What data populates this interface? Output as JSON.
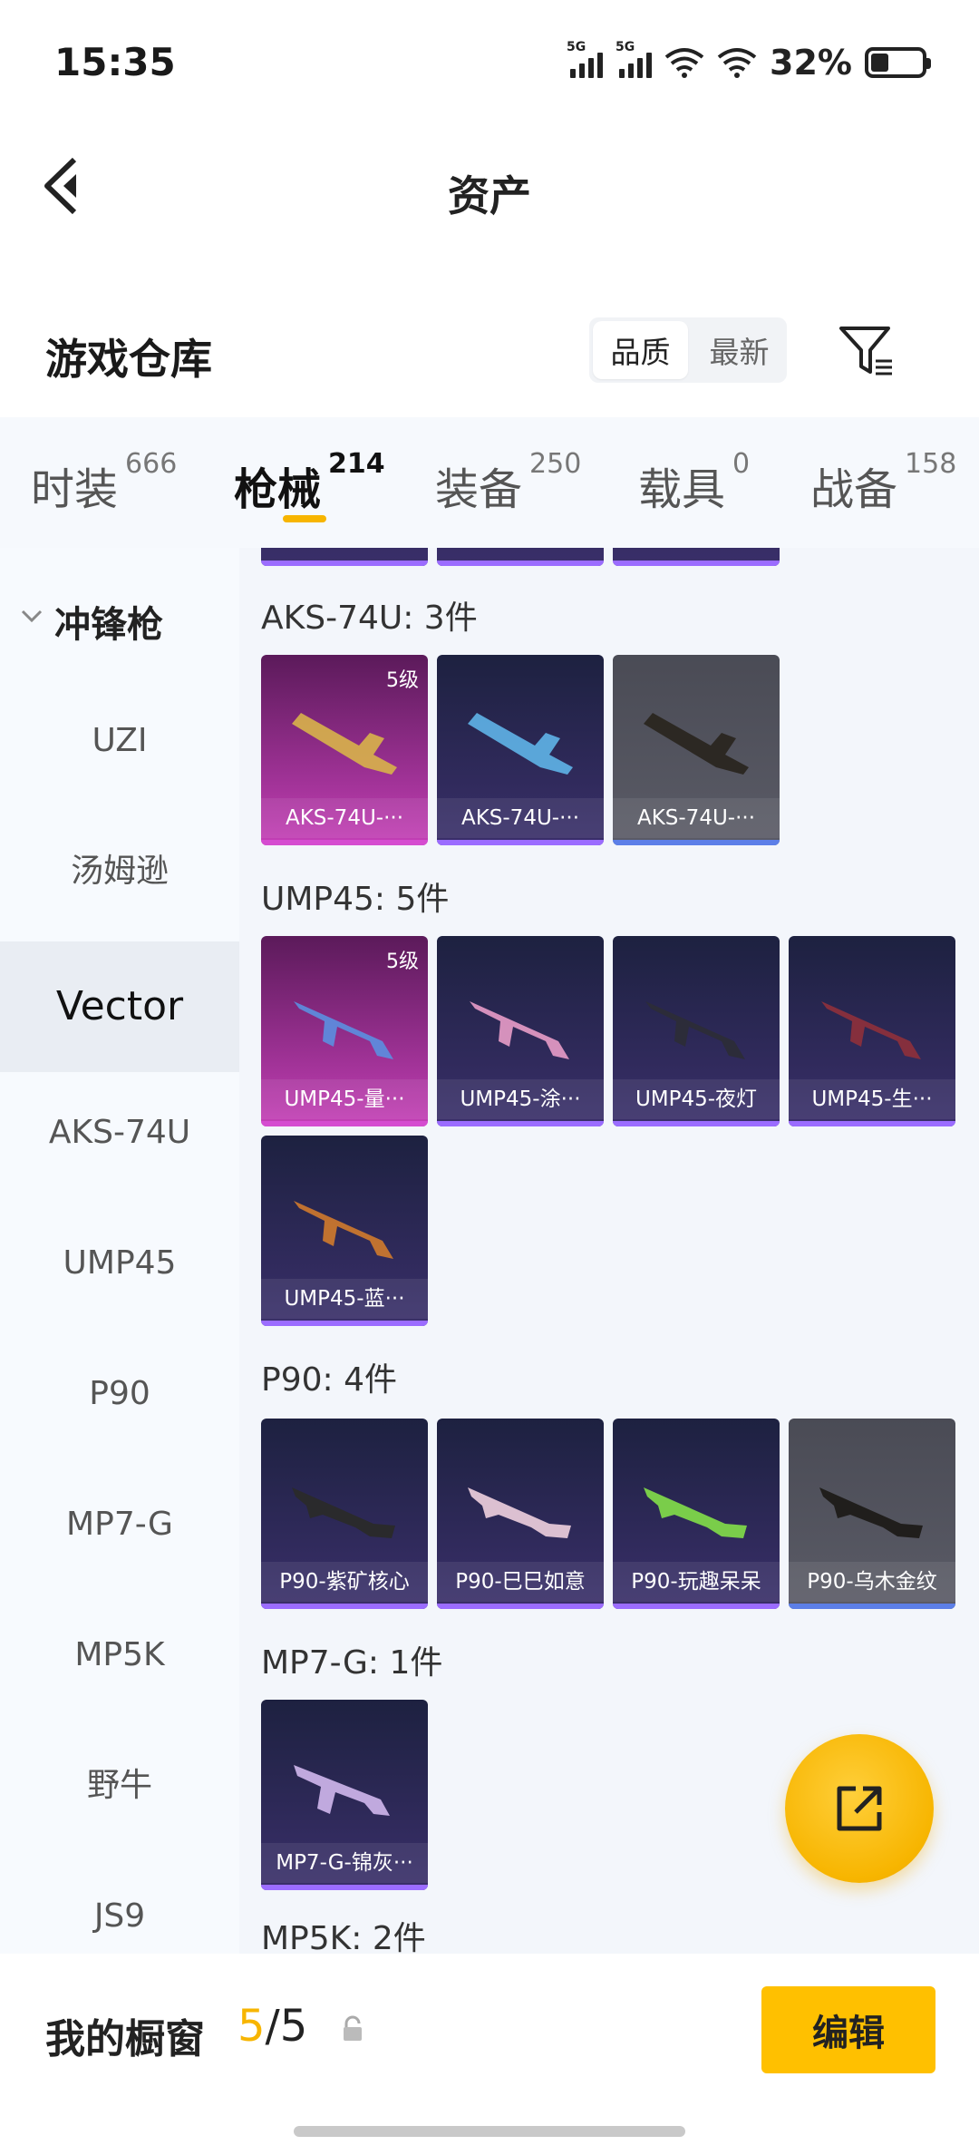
{
  "status_bar": {
    "time": "15:35",
    "signal1_tag": "5G",
    "signal2_tag": "5G",
    "battery": "32%"
  },
  "header": {
    "title": "资产"
  },
  "warehouse": {
    "title": "游戏仓库",
    "sort_quality": "品质",
    "sort_latest": "最新"
  },
  "tabs": [
    {
      "label": "时装",
      "count": "666"
    },
    {
      "label": "枪械",
      "count": "214"
    },
    {
      "label": "装备",
      "count": "250"
    },
    {
      "label": "载具",
      "count": "0"
    },
    {
      "label": "战备",
      "count": "158"
    }
  ],
  "categories": {
    "group": "冲锋枪",
    "items": [
      "UZI",
      "汤姆逊",
      "Vector",
      "AKS-74U",
      "UMP45",
      "P90",
      "MP7-G",
      "MP5K",
      "野牛",
      "JS9"
    ],
    "selected": "Vector"
  },
  "sections": {
    "aks": {
      "title": "AKS-74U: 3件",
      "items": [
        {
          "label": "AKS-74U-···",
          "level": "5级",
          "rarity": "purple"
        },
        {
          "label": "AKS-74U-···",
          "rarity": "blue"
        },
        {
          "label": "AKS-74U-···",
          "rarity": "grey"
        }
      ]
    },
    "ump": {
      "title": "UMP45: 5件",
      "items": [
        {
          "label": "UMP45-量···",
          "level": "5级",
          "rarity": "purple"
        },
        {
          "label": "UMP45-涂···",
          "rarity": "blue"
        },
        {
          "label": "UMP45-夜灯",
          "rarity": "blue"
        },
        {
          "label": "UMP45-生···",
          "rarity": "blue"
        },
        {
          "label": "UMP45-蓝···",
          "rarity": "blue"
        }
      ]
    },
    "p90": {
      "title": "P90: 4件",
      "items": [
        {
          "label": "P90-紫矿核心",
          "rarity": "blue"
        },
        {
          "label": "P90-巳巳如意",
          "rarity": "blue"
        },
        {
          "label": "P90-玩趣呆呆",
          "rarity": "blue"
        },
        {
          "label": "P90-乌木金纹",
          "rarity": "grey"
        }
      ]
    },
    "mp7": {
      "title": "MP7-G: 1件",
      "items": [
        {
          "label": "MP7-G-锦灰···",
          "rarity": "blue"
        }
      ]
    },
    "mp5k": {
      "title": "MP5K: 2件"
    }
  },
  "bottom_bar": {
    "label": "我的橱窗",
    "count_current": "5",
    "count_sep_total": "/5",
    "edit": "编辑"
  },
  "colors": {
    "accent": "#f7b500",
    "blue_rarity": "#9b6cff",
    "purple_rarity": "#d54cd0",
    "grey_rarity": "#5c7fe8"
  },
  "icons": [
    "back-arrow-icon",
    "filter-icon",
    "chevron-down-icon",
    "lock-icon",
    "share-external-icon",
    "wifi-icon",
    "battery-icon"
  ]
}
